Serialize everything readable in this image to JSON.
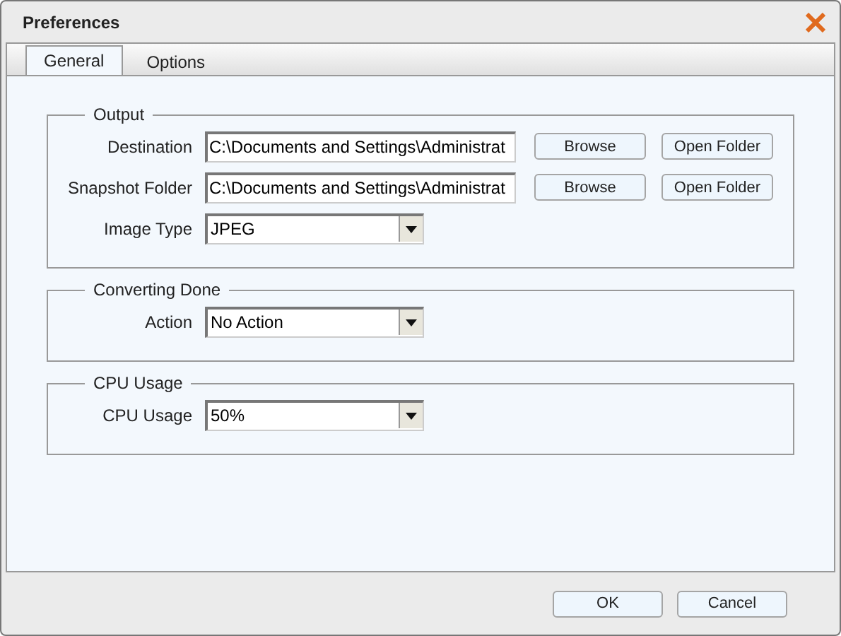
{
  "window": {
    "title": "Preferences"
  },
  "tabs": [
    {
      "label": "General",
      "selected": true
    },
    {
      "label": "Options",
      "selected": false
    }
  ],
  "groups": [
    {
      "title": "Output",
      "rows": [
        {
          "label": "Destination",
          "kind": "text",
          "value": "C:\\Documents and Settings\\Administrat",
          "buttons": [
            "Browse",
            "Open Folder"
          ]
        },
        {
          "label": "Snapshot Folder",
          "kind": "text",
          "value": "C:\\Documents and Settings\\Administrat",
          "buttons": [
            "Browse",
            "Open Folder"
          ]
        },
        {
          "label": "Image Type",
          "kind": "select",
          "value": "JPEG"
        }
      ]
    },
    {
      "title": "Converting Done",
      "rows": [
        {
          "label": "Action",
          "kind": "select",
          "value": "No Action"
        }
      ]
    },
    {
      "title": "CPU Usage",
      "rows": [
        {
          "label": "CPU Usage",
          "kind": "select",
          "value": "50%"
        }
      ]
    }
  ],
  "buttons": [
    "OK",
    "Cancel"
  ]
}
